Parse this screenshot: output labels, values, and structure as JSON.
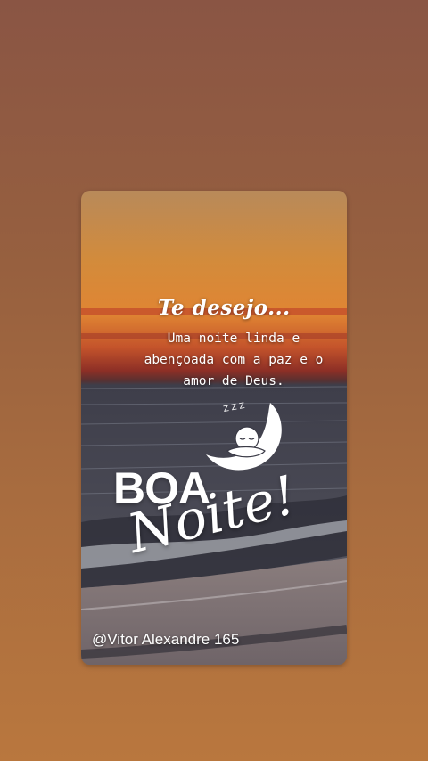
{
  "colors": {
    "page_background": "#9a6240",
    "sky_top": "#d98a3c",
    "horizon": "#c04a2a",
    "sea": "#3a3a46",
    "text": "#ffffff"
  },
  "card": {
    "headline": "Te desejo...",
    "message": "Uma noite linda e abençoada com a paz e o amor de Deus.",
    "moon_icon": "sleeping-baby-moon-icon",
    "zzz": "Z Z Z",
    "boa": "BOA",
    "noite": "Noite!",
    "watermark": "@Vitor Alexandre 165"
  }
}
